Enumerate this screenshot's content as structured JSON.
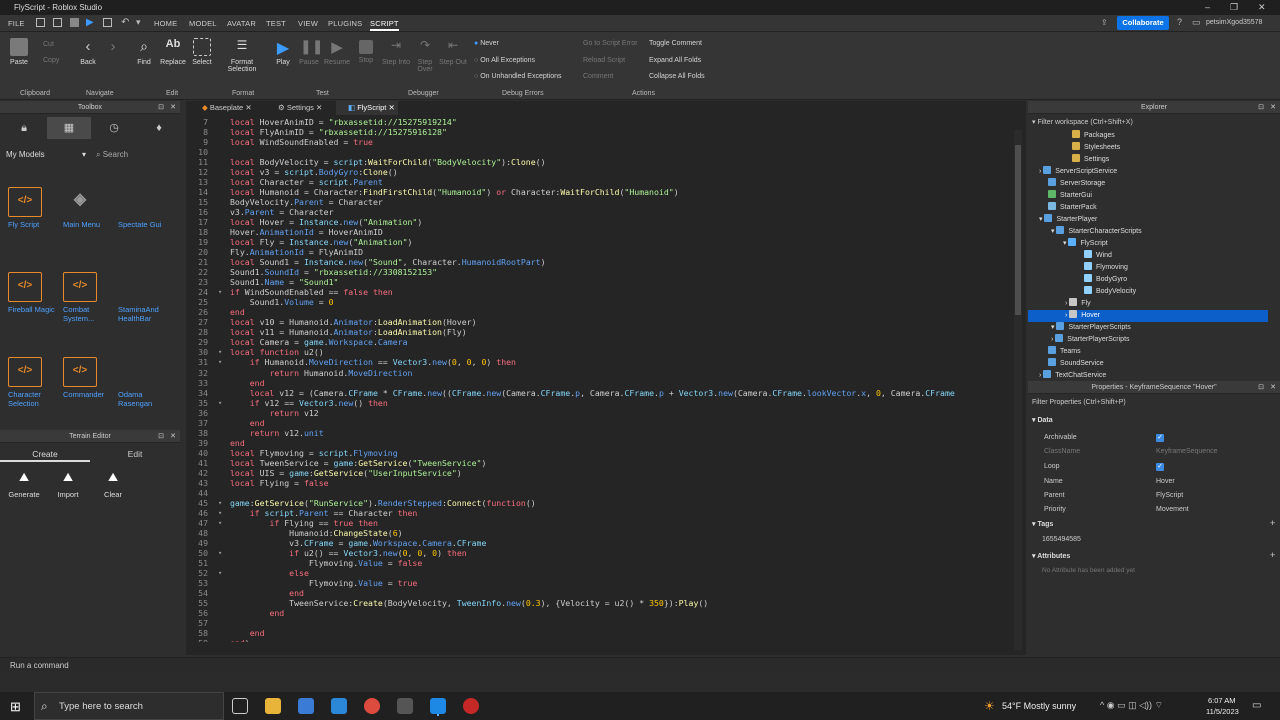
{
  "window": {
    "title": "FlyScript - Roblox Studio"
  },
  "menu": {
    "file": "FILE",
    "tabs": [
      "HOME",
      "MODEL",
      "AVATAR",
      "TEST",
      "VIEW",
      "PLUGINS",
      "SCRIPT"
    ],
    "collaborate": "Collaborate",
    "user": "petsimXgod35578"
  },
  "ribbon": {
    "paste": "Paste",
    "cut": "Cut",
    "copy": "Copy",
    "back": "Back",
    "find": "Find",
    "replace": "Replace",
    "select": "Select",
    "format": "Format Selection",
    "play": "Play",
    "pause": "Pause",
    "resume": "Resume",
    "stop": "Stop",
    "step_into": "Step Into",
    "step_over": "Step Over",
    "step_out": "Step Out",
    "never": "Never",
    "all_exceptions": "On All Exceptions",
    "unhandled": "On Unhandled Exceptions",
    "goto_error": "Go to Script Error",
    "reload": "Reload Script",
    "comment": "Comment",
    "toggle_comment": "Toggle Comment",
    "expand_folds": "Expand All Folds",
    "collapse_folds": "Collapse All Folds",
    "groups": [
      "Clipboard",
      "Navigate",
      "Edit",
      "Format",
      "Test",
      "Debugger",
      "Debug Errors",
      "Actions"
    ]
  },
  "toolbox": {
    "title": "Toolbox",
    "category": "My Models",
    "search_placeholder": "Search",
    "models": [
      "Fly Script",
      "Main Menu",
      "Spectate Gui",
      "Fireball Magic",
      "Combat System...",
      "StaminaAnd HealthBar",
      "Character Selection",
      "Commander",
      "Odama Rasengan"
    ]
  },
  "terrain": {
    "title": "Terrain Editor",
    "tabs": [
      "Create",
      "Edit"
    ],
    "tools": [
      "Generate",
      "Import",
      "Clear"
    ]
  },
  "editor": {
    "tabs": [
      "Baseplate",
      "Settings",
      "FlyScript"
    ],
    "line_numbers": [
      7,
      8,
      9,
      10,
      11,
      12,
      13,
      14,
      15,
      16,
      17,
      18,
      19,
      20,
      21,
      22,
      23,
      24,
      25,
      26,
      27,
      28,
      29,
      30,
      31,
      32,
      33,
      34,
      35,
      36,
      37,
      38,
      39,
      40,
      41,
      42,
      43,
      44,
      45,
      46,
      47,
      48,
      49,
      50,
      51,
      52,
      53,
      54,
      55,
      56,
      57,
      58,
      59
    ],
    "lines": [
      "local HoverAnimID = \"rbxassetid://15275919214\"",
      "local FlyAnimID = \"rbxassetid://15275916128\"",
      "local WindSoundEnabled = true",
      "",
      "local BodyVelocity = script:WaitForChild(\"BodyVelocity\"):Clone()",
      "local v3 = script.BodyGyro:Clone()",
      "local Character = script.Parent",
      "local Humanoid = Character:FindFirstChild(\"Humanoid\") or Character:WaitForChild(\"Humanoid\")",
      "BodyVelocity.Parent = Character",
      "v3.Parent = Character",
      "local Hover = Instance.new(\"Animation\")",
      "Hover.AnimationId = HoverAnimID",
      "local Fly = Instance.new(\"Animation\")",
      "Fly.AnimationId = FlyAnimID",
      "local Sound1 = Instance.new(\"Sound\", Character.HumanoidRootPart)",
      "Sound1.SoundId = \"rbxassetid://3308152153\"",
      "Sound1.Name = \"Sound1\"",
      "if WindSoundEnabled == false then",
      "    Sound1.Volume = 0",
      "end",
      "local v10 = Humanoid.Animator:LoadAnimation(Hover)",
      "local v11 = Humanoid.Animator:LoadAnimation(Fly)",
      "local Camera = game.Workspace.Camera",
      "local function u2()",
      "    if Humanoid.MoveDirection == Vector3.new(0, 0, 0) then",
      "        return Humanoid.MoveDirection",
      "    end",
      "    local v12 = (Camera.CFrame * CFrame.new((CFrame.new(Camera.CFrame.p, Camera.CFrame.p + Vector3.new(Camera.CFrame.lookVector.x, 0, Camera.CFrame",
      "    if v12 == Vector3.new() then",
      "        return v12",
      "    end",
      "    return v12.unit",
      "end",
      "local Flymoving = script.Flymoving",
      "local TweenService = game:GetService(\"TweenService\")",
      "local UIS = game:GetService(\"UserInputService\")",
      "local Flying = false",
      "",
      "game:GetService(\"RunService\").RenderStepped:Connect(function()",
      "    if script.Parent == Character then",
      "        if Flying == true then",
      "            Humanoid:ChangeState(6)",
      "            v3.CFrame = game.Workspace.Camera.CFrame",
      "            if u2() == Vector3.new(0, 0, 0) then",
      "                Flymoving.Value = false",
      "            else",
      "                Flymoving.Value = true",
      "            end",
      "            TweenService:Create(BodyVelocity, TweenInfo.new(0.3), {Velocity = u2() * 350}):Play()",
      "        end",
      "",
      "    end",
      "end)"
    ]
  },
  "explorer": {
    "title": "Explorer",
    "filter": "Filter workspace (Ctrl+Shift+X)",
    "items": [
      "Packages",
      "Stylesheets",
      "Settings",
      "ServerScriptService",
      "ServerStorage",
      "StarterGui",
      "StarterPack",
      "StarterPlayer",
      "StarterCharacterScripts",
      "FlyScript",
      "Wind",
      "Flymoving",
      "BodyGyro",
      "BodyVelocity",
      "Fly",
      "Hover",
      "StarterPlayerScripts",
      "StarterPlayerScripts",
      "Teams",
      "SoundService",
      "TextChatService"
    ]
  },
  "properties": {
    "title": "Properties - KeyframeSequence \"Hover\"",
    "filter": "Filter Properties (Ctrl+Shift+P)",
    "data_label": "Data",
    "tags_label": "Tags",
    "attributes_label": "Attributes",
    "rows": [
      {
        "k": "Archivable",
        "v": ""
      },
      {
        "k": "ClassName",
        "v": "KeyframeSequence"
      },
      {
        "k": "Loop",
        "v": ""
      },
      {
        "k": "Name",
        "v": "Hover"
      },
      {
        "k": "Parent",
        "v": "FlyScript"
      },
      {
        "k": "Priority",
        "v": "Movement"
      }
    ],
    "tag_value": "1655494585",
    "no_attr": "No Attribute has been added yet"
  },
  "command": {
    "placeholder": "Run a command"
  },
  "taskbar": {
    "search": "Type here to search",
    "weather": "54°F  Mostly sunny",
    "time": "6:07 AM",
    "date": "11/5/2023"
  }
}
